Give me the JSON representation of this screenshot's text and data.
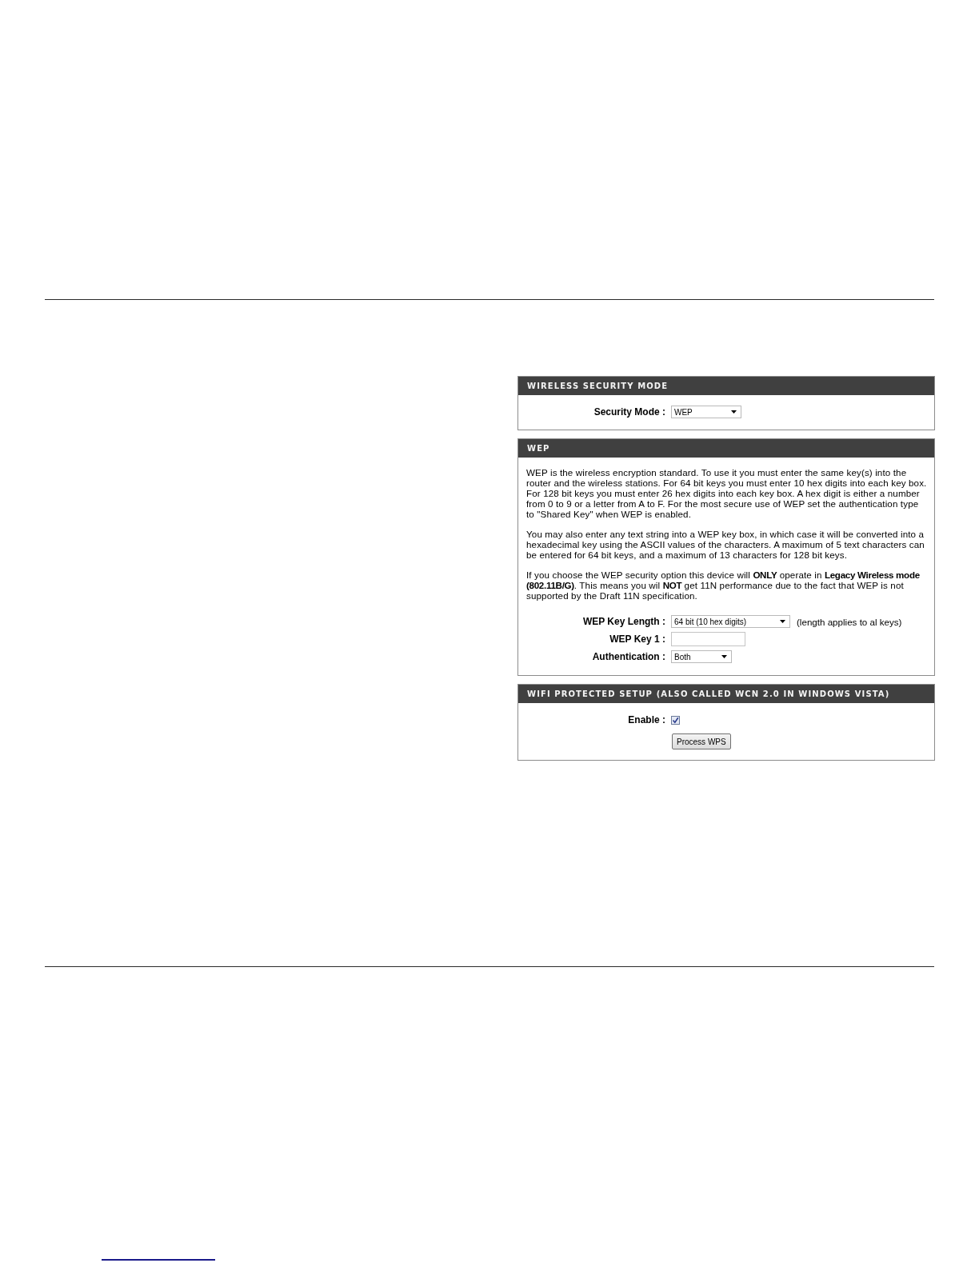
{
  "sections": [
    {
      "title": "WIRELESS SECURITY MODE",
      "rows": [
        {
          "kind": "select",
          "label": "Security Mode :",
          "value": "WEP"
        }
      ]
    },
    {
      "title": "WEP",
      "paragraphs": [
        "WEP is the wireless encryption standard. To use it you must enter the same key(s) into the router and the wireless stations. For 64 bit keys you must enter 10 hex digits into each key box. For 128 bit keys you must enter 26 hex digits into each key box. A hex digit is either a number from 0 to 9 or a letter from A to F. For the most secure use of WEP set the authentication type to \"Shared Key\" when WEP is enabled.",
        "You may also enter any text string into a WEP key box, in which case it will be converted into a hexadecimal key using the ASCII values of the characters. A maximum of 5 text characters can be entered for 64 bit keys, and a maximum of 13 characters for 128 bit keys.",
        "If you choose the WEP security option this device will **ONLY** operate in **Legacy Wireless mode (802.11B/G)**. This means you wil **NOT** get 11N performance due to the fact that WEP is not supported by the Draft 11N specification."
      ],
      "rows": [
        {
          "kind": "select",
          "label": "WEP Key Length :",
          "value": "64 bit (10 hex digits)",
          "hint": "(length applies to al keys)"
        },
        {
          "kind": "input",
          "label": "WEP Key 1 :"
        },
        {
          "kind": "select",
          "label": "Authentication :",
          "value": "Both"
        }
      ]
    },
    {
      "title": "WIFI PROTECTED SETUP (ALSO CALLED WCN 2.0 IN WINDOWS VISTA)",
      "rows": [
        {
          "kind": "checkbox",
          "label": "Enable :",
          "checked": true
        },
        {
          "kind": "button",
          "label": "Process WPS"
        }
      ]
    }
  ]
}
